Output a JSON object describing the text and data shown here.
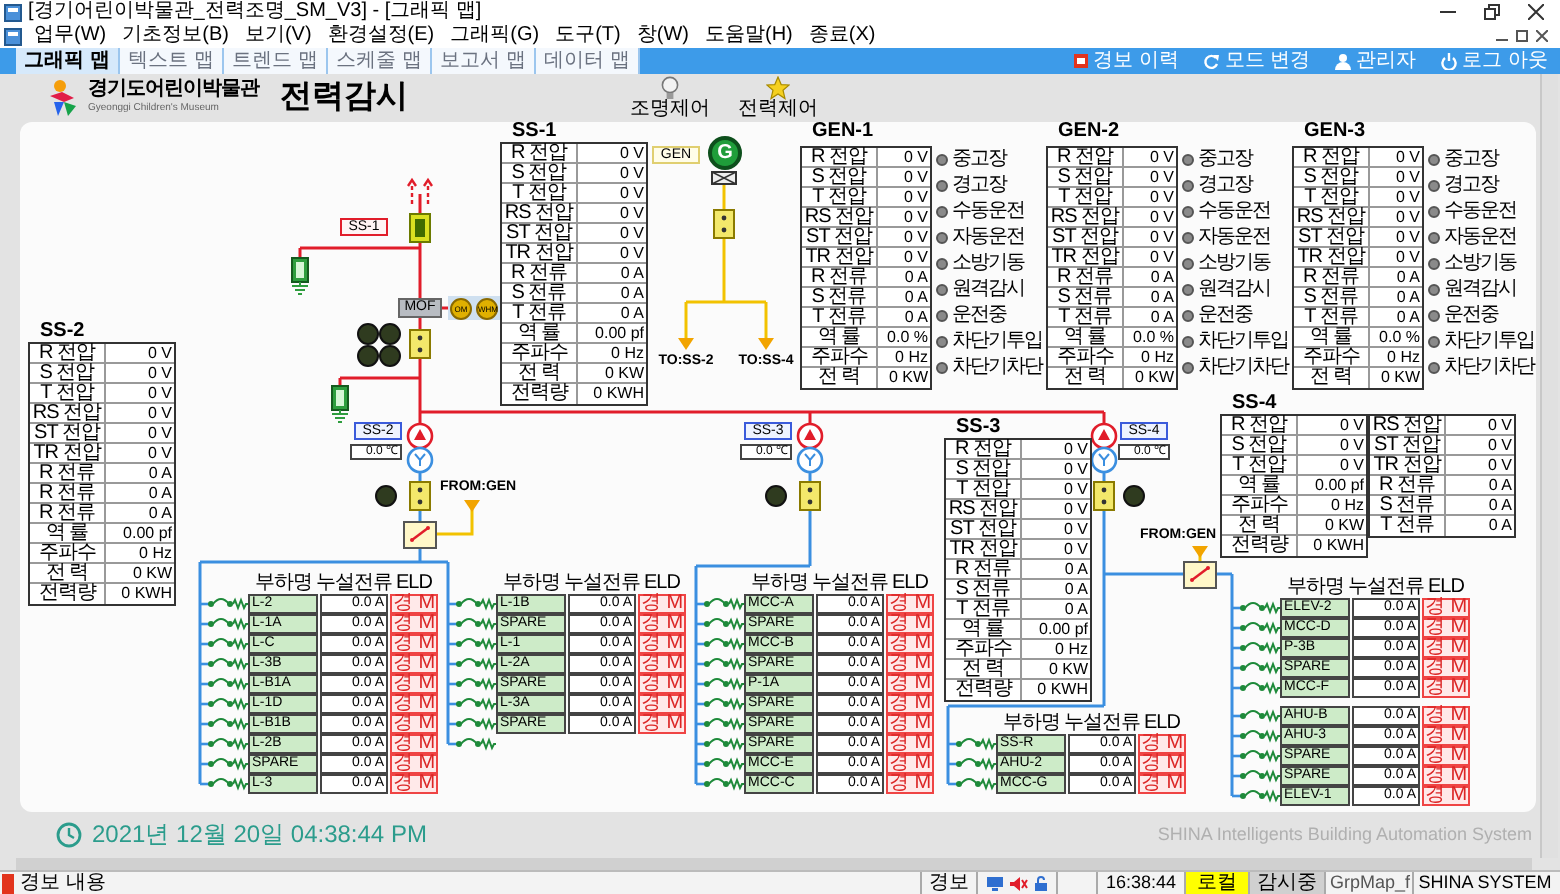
{
  "window": {
    "title": "[경기어린이박물관_전력조명_SM_V3] - [그래픽 맵]"
  },
  "menu": [
    "업무(W)",
    "기초정보(B)",
    "보기(V)",
    "환경설정(E)",
    "그래픽(G)",
    "도구(T)",
    "창(W)",
    "도움말(H)",
    "종료(X)"
  ],
  "tabs": [
    {
      "label": "그래픽 맵",
      "selected": true
    },
    {
      "label": "텍스트 맵",
      "selected": false
    },
    {
      "label": "트렌드 맵",
      "selected": false
    },
    {
      "label": "스케줄 맵",
      "selected": false
    },
    {
      "label": "보고서 맵",
      "selected": false
    },
    {
      "label": "데이터 맵",
      "selected": false
    }
  ],
  "toolbar_buttons": [
    "경보 이력",
    "모드 변경",
    "관리자",
    "로그 아웃"
  ],
  "header": {
    "logo_text": "경기도어린이박물관",
    "logo_subtitle": "Gyeonggi Children's Museum",
    "title": "전력감시",
    "buttons": [
      "조명제어",
      "전력제어"
    ]
  },
  "diagram": {
    "incoming_tag": "SS-1",
    "generator": {
      "tag": "GEN",
      "symbol": "G"
    },
    "meter_box": {
      "mof": "MOF",
      "gauges": [
        "OM",
        "WHM"
      ]
    },
    "substations": [
      {
        "tag": "SS-2",
        "temperature": "0.0 ℃"
      },
      {
        "tag": "SS-3",
        "temperature": "0.0 ℃"
      },
      {
        "tag": "SS-4",
        "temperature": "0.0 ℃"
      }
    ],
    "to_labels": [
      "TO:SS-2",
      "TO:SS-4"
    ],
    "from_labels": [
      "FROM:GEN",
      "FROM:GEN"
    ]
  },
  "meters": [
    {
      "title": "SS-1",
      "columns": [
        [
          {
            "label": "R 전압",
            "value": "0 V"
          },
          {
            "label": "S 전압",
            "value": "0 V"
          },
          {
            "label": "T 전압",
            "value": "0 V"
          },
          {
            "label": "RS 전압",
            "value": "0 V"
          },
          {
            "label": "ST 전압",
            "value": "0 V"
          },
          {
            "label": "TR 전압",
            "value": "0 V"
          },
          {
            "label": "R 전류",
            "value": "0 A"
          },
          {
            "label": "S 전류",
            "value": "0 A"
          },
          {
            "label": "T 전류",
            "value": "0 A"
          },
          {
            "label": "역 률",
            "value": "0.00 pf"
          },
          {
            "label": "주파수",
            "value": "0 Hz"
          },
          {
            "label": "전 력",
            "value": "0 KW"
          },
          {
            "label": "전력량",
            "value": "0 KWH"
          }
        ]
      ]
    },
    {
      "title": "SS-2",
      "columns": [
        [
          {
            "label": "R 전압",
            "value": "0 V"
          },
          {
            "label": "S 전압",
            "value": "0 V"
          },
          {
            "label": "T 전압",
            "value": "0 V"
          },
          {
            "label": "RS 전압",
            "value": "0 V"
          },
          {
            "label": "ST 전압",
            "value": "0 V"
          },
          {
            "label": "TR 전압",
            "value": "0 V"
          },
          {
            "label": "R 전류",
            "value": "0 A"
          },
          {
            "label": "R 전류",
            "value": "0 A"
          },
          {
            "label": "R 전류",
            "value": "0 A"
          },
          {
            "label": "역 률",
            "value": "0.00 pf"
          },
          {
            "label": "주파수",
            "value": "0 Hz"
          },
          {
            "label": "전 력",
            "value": "0 KW"
          },
          {
            "label": "전력량",
            "value": "0 KWH"
          }
        ]
      ]
    },
    {
      "title": "SS-3",
      "columns": [
        [
          {
            "label": "R 전압",
            "value": "0 V"
          },
          {
            "label": "S 전압",
            "value": "0 V"
          },
          {
            "label": "T 전압",
            "value": "0 V"
          },
          {
            "label": "RS 전압",
            "value": "0 V"
          },
          {
            "label": "ST 전압",
            "value": "0 V"
          },
          {
            "label": "TR 전압",
            "value": "0 V"
          },
          {
            "label": "R 전류",
            "value": "0 A"
          },
          {
            "label": "S 전류",
            "value": "0 A"
          },
          {
            "label": "T 전류",
            "value": "0 A"
          },
          {
            "label": "역 률",
            "value": "0.00 pf"
          },
          {
            "label": "주파수",
            "value": "0 Hz"
          },
          {
            "label": "전 력",
            "value": "0 KW"
          },
          {
            "label": "전력량",
            "value": "0 KWH"
          }
        ]
      ]
    },
    {
      "title": "SS-4",
      "columns": [
        [
          {
            "label": "R 전압",
            "value": "0 V"
          },
          {
            "label": "S 전압",
            "value": "0 V"
          },
          {
            "label": "T 전압",
            "value": "0 V"
          },
          {
            "label": "역 률",
            "value": "0.00 pf"
          },
          {
            "label": "주파수",
            "value": "0 Hz"
          },
          {
            "label": "전 력",
            "value": "0 KW"
          },
          {
            "label": "전력량",
            "value": "0 KWH"
          }
        ],
        [
          {
            "label": "RS 전압",
            "value": "0 V"
          },
          {
            "label": "ST 전압",
            "value": "0 V"
          },
          {
            "label": "TR 전압",
            "value": "0 V"
          },
          {
            "label": "R 전류",
            "value": "0 A"
          },
          {
            "label": "S 전류",
            "value": "0 A"
          },
          {
            "label": "T 전류",
            "value": "0 A"
          }
        ]
      ]
    }
  ],
  "generators": [
    {
      "title": "GEN-1",
      "rows": [
        {
          "label": "R 전압",
          "value": "0 V"
        },
        {
          "label": "S 전압",
          "value": "0 V"
        },
        {
          "label": "T 전압",
          "value": "0 V"
        },
        {
          "label": "RS 전압",
          "value": "0 V"
        },
        {
          "label": "ST 전압",
          "value": "0 V"
        },
        {
          "label": "TR 전압",
          "value": "0 V"
        },
        {
          "label": "R 전류",
          "value": "0 A"
        },
        {
          "label": "S 전류",
          "value": "0 A"
        },
        {
          "label": "T 전류",
          "value": "0 A"
        },
        {
          "label": "역 률",
          "value": "0.0 %"
        },
        {
          "label": "주파수",
          "value": "0 Hz"
        },
        {
          "label": "전 력",
          "value": "0 KW"
        }
      ],
      "lamps": [
        {
          "label": "중고장",
          "on": false
        },
        {
          "label": "경고장",
          "on": false
        },
        {
          "label": "수동운전",
          "on": false
        },
        {
          "label": "자동운전",
          "on": false
        },
        {
          "label": "소방기동",
          "on": false
        },
        {
          "label": "원격감시",
          "on": false
        },
        {
          "label": "운전중",
          "on": false
        },
        {
          "label": "차단기투입",
          "on": false
        },
        {
          "label": "차단기차단",
          "on": false
        }
      ]
    },
    {
      "title": "GEN-2",
      "rows": [
        {
          "label": "R 전압",
          "value": "0 V"
        },
        {
          "label": "S 전압",
          "value": "0 V"
        },
        {
          "label": "T 전압",
          "value": "0 V"
        },
        {
          "label": "RS 전압",
          "value": "0 V"
        },
        {
          "label": "ST 전압",
          "value": "0 V"
        },
        {
          "label": "TR 전압",
          "value": "0 V"
        },
        {
          "label": "R 전류",
          "value": "0 A"
        },
        {
          "label": "S 전류",
          "value": "0 A"
        },
        {
          "label": "T 전류",
          "value": "0 A"
        },
        {
          "label": "역 률",
          "value": "0.0 %"
        },
        {
          "label": "주파수",
          "value": "0 Hz"
        },
        {
          "label": "전 력",
          "value": "0 KW"
        }
      ],
      "lamps": [
        {
          "label": "중고장",
          "on": false
        },
        {
          "label": "경고장",
          "on": false
        },
        {
          "label": "수동운전",
          "on": false
        },
        {
          "label": "자동운전",
          "on": false
        },
        {
          "label": "소방기동",
          "on": false
        },
        {
          "label": "원격감시",
          "on": false
        },
        {
          "label": "운전중",
          "on": false
        },
        {
          "label": "차단기투입",
          "on": false
        },
        {
          "label": "차단기차단",
          "on": false
        }
      ]
    },
    {
      "title": "GEN-3",
      "rows": [
        {
          "label": "R 전압",
          "value": "0 V"
        },
        {
          "label": "S 전압",
          "value": "0 V"
        },
        {
          "label": "T 전압",
          "value": "0 V"
        },
        {
          "label": "RS 전압",
          "value": "0 V"
        },
        {
          "label": "ST 전압",
          "value": "0 V"
        },
        {
          "label": "TR 전압",
          "value": "0 V"
        },
        {
          "label": "R 전류",
          "value": "0 A"
        },
        {
          "label": "S 전류",
          "value": "0 A"
        },
        {
          "label": "T 전류",
          "value": "0 A"
        },
        {
          "label": "역 률",
          "value": "0.0 %"
        },
        {
          "label": "주파수",
          "value": "0 Hz"
        },
        {
          "label": "전 력",
          "value": "0 KW"
        }
      ],
      "lamps": [
        {
          "label": "중고장",
          "on": false
        },
        {
          "label": "경고장",
          "on": false
        },
        {
          "label": "수동운전",
          "on": false
        },
        {
          "label": "자동운전",
          "on": false
        },
        {
          "label": "소방기동",
          "on": false
        },
        {
          "label": "원격감시",
          "on": false
        },
        {
          "label": "운전중",
          "on": false
        },
        {
          "label": "차단기투입",
          "on": false
        },
        {
          "label": "차단기차단",
          "on": false
        }
      ]
    }
  ],
  "feeder_groups": [
    {
      "headers": [
        "부하명",
        "누설전류",
        "ELD"
      ],
      "rows": [
        {
          "kind": "load",
          "name": "L-2",
          "current": "0.0 A",
          "eld": "경 M"
        },
        {
          "kind": "load",
          "name": "L-1A",
          "current": "0.0 A",
          "eld": "경 M"
        },
        {
          "kind": "load",
          "name": "L-C",
          "current": "0.0 A",
          "eld": "경 M"
        },
        {
          "kind": "load",
          "name": "L-3B",
          "current": "0.0 A",
          "eld": "경 M"
        },
        {
          "kind": "load",
          "name": "L-B1A",
          "current": "0.0 A",
          "eld": "경 M"
        },
        {
          "kind": "load",
          "name": "L-1D",
          "current": "0.0 A",
          "eld": "경 M"
        },
        {
          "kind": "load",
          "name": "L-B1B",
          "current": "0.0 A",
          "eld": "경 M"
        },
        {
          "kind": "load",
          "name": "L-2B",
          "current": "0.0 A",
          "eld": "경 M"
        },
        {
          "kind": "load",
          "name": "SPARE",
          "current": "0.0 A",
          "eld": "경 M"
        },
        {
          "kind": "load",
          "name": "L-3",
          "current": "0.0 A",
          "eld": "경 M"
        }
      ]
    },
    {
      "headers": [
        "부하명",
        "누설전류",
        "ELD"
      ],
      "rows": [
        {
          "kind": "load",
          "name": "L-1B",
          "current": "0.0 A",
          "eld": "경 M"
        },
        {
          "kind": "load",
          "name": "SPARE",
          "current": "0.0 A",
          "eld": "경 M"
        },
        {
          "kind": "load",
          "name": "L-1",
          "current": "0.0 A",
          "eld": "경 M"
        },
        {
          "kind": "load",
          "name": "L-2A",
          "current": "0.0 A",
          "eld": "경 M"
        },
        {
          "kind": "load",
          "name": "SPARE",
          "current": "0.0 A",
          "eld": "경 M"
        },
        {
          "kind": "load",
          "name": "L-3A",
          "current": "0.0 A",
          "eld": "경 M"
        },
        {
          "kind": "load",
          "name": "SPARE",
          "current": "0.0 A",
          "eld": "경 M"
        },
        {
          "kind": "breaker"
        }
      ]
    },
    {
      "headers": [
        "부하명",
        "누설전류",
        "ELD"
      ],
      "rows": [
        {
          "kind": "load",
          "name": "MCC-A",
          "current": "0.0 A",
          "eld": "경 M"
        },
        {
          "kind": "load",
          "name": "SPARE",
          "current": "0.0 A",
          "eld": "경 M"
        },
        {
          "kind": "load",
          "name": "MCC-B",
          "current": "0.0 A",
          "eld": "경 M"
        },
        {
          "kind": "load",
          "name": "SPARE",
          "current": "0.0 A",
          "eld": "경 M"
        },
        {
          "kind": "load",
          "name": "P-1A",
          "current": "0.0 A",
          "eld": "경 M"
        },
        {
          "kind": "load",
          "name": "SPARE",
          "current": "0.0 A",
          "eld": "경 M"
        },
        {
          "kind": "load",
          "name": "SPARE",
          "current": "0.0 A",
          "eld": "경 M"
        },
        {
          "kind": "load",
          "name": "SPARE",
          "current": "0.0 A",
          "eld": "경 M"
        },
        {
          "kind": "load",
          "name": "MCC-E",
          "current": "0.0 A",
          "eld": "경 M"
        },
        {
          "kind": "load",
          "name": "MCC-C",
          "current": "0.0 A",
          "eld": "경 M"
        }
      ]
    },
    {
      "headers": [
        "부하명",
        "누설전류",
        "ELD"
      ],
      "rows": [
        {
          "kind": "load",
          "name": "SS-R",
          "current": "0.0 A",
          "eld": "경 M"
        },
        {
          "kind": "load",
          "name": "AHU-2",
          "current": "0.0 A",
          "eld": "경 M"
        },
        {
          "kind": "load",
          "name": "MCC-G",
          "current": "0.0 A",
          "eld": "경 M"
        }
      ]
    },
    {
      "headers": [
        "부하명",
        "누설전류",
        "ELD"
      ],
      "rows": [
        {
          "kind": "load",
          "name": "ELEV-2",
          "current": "0.0 A",
          "eld": "경 M"
        },
        {
          "kind": "load",
          "name": "MCC-D",
          "current": "0.0 A",
          "eld": "경 M"
        },
        {
          "kind": "load",
          "name": "P-3B",
          "current": "0.0 A",
          "eld": "경 M"
        },
        {
          "kind": "load",
          "name": "SPARE",
          "current": "0.0 A",
          "eld": "경 M"
        },
        {
          "kind": "load",
          "name": "MCC-F",
          "current": "0.0 A",
          "eld": "경 M"
        }
      ]
    },
    {
      "rows": [
        {
          "kind": "load",
          "name": "AHU-B",
          "current": "0.0 A",
          "eld": "경 M"
        },
        {
          "kind": "load",
          "name": "AHU-3",
          "current": "0.0 A",
          "eld": "경 M"
        },
        {
          "kind": "load",
          "name": "SPARE",
          "current": "0.0 A",
          "eld": "경 M"
        },
        {
          "kind": "load",
          "name": "SPARE",
          "current": "0.0 A",
          "eld": "경 M"
        },
        {
          "kind": "load",
          "name": "ELEV-1",
          "current": "0.0 A",
          "eld": "경 M"
        }
      ]
    }
  ],
  "footer": {
    "datetime": "2021년 12월 20일 04:38:44 PM",
    "brand": "SHINA Intelligents Building Automation System"
  },
  "status_bar": {
    "message": "경보 내용",
    "alarm": "경보",
    "time": "16:38:44",
    "mode": "로컬",
    "state": "감시중",
    "screen": "GrpMap_f",
    "company": "SHINA SYSTEM"
  }
}
